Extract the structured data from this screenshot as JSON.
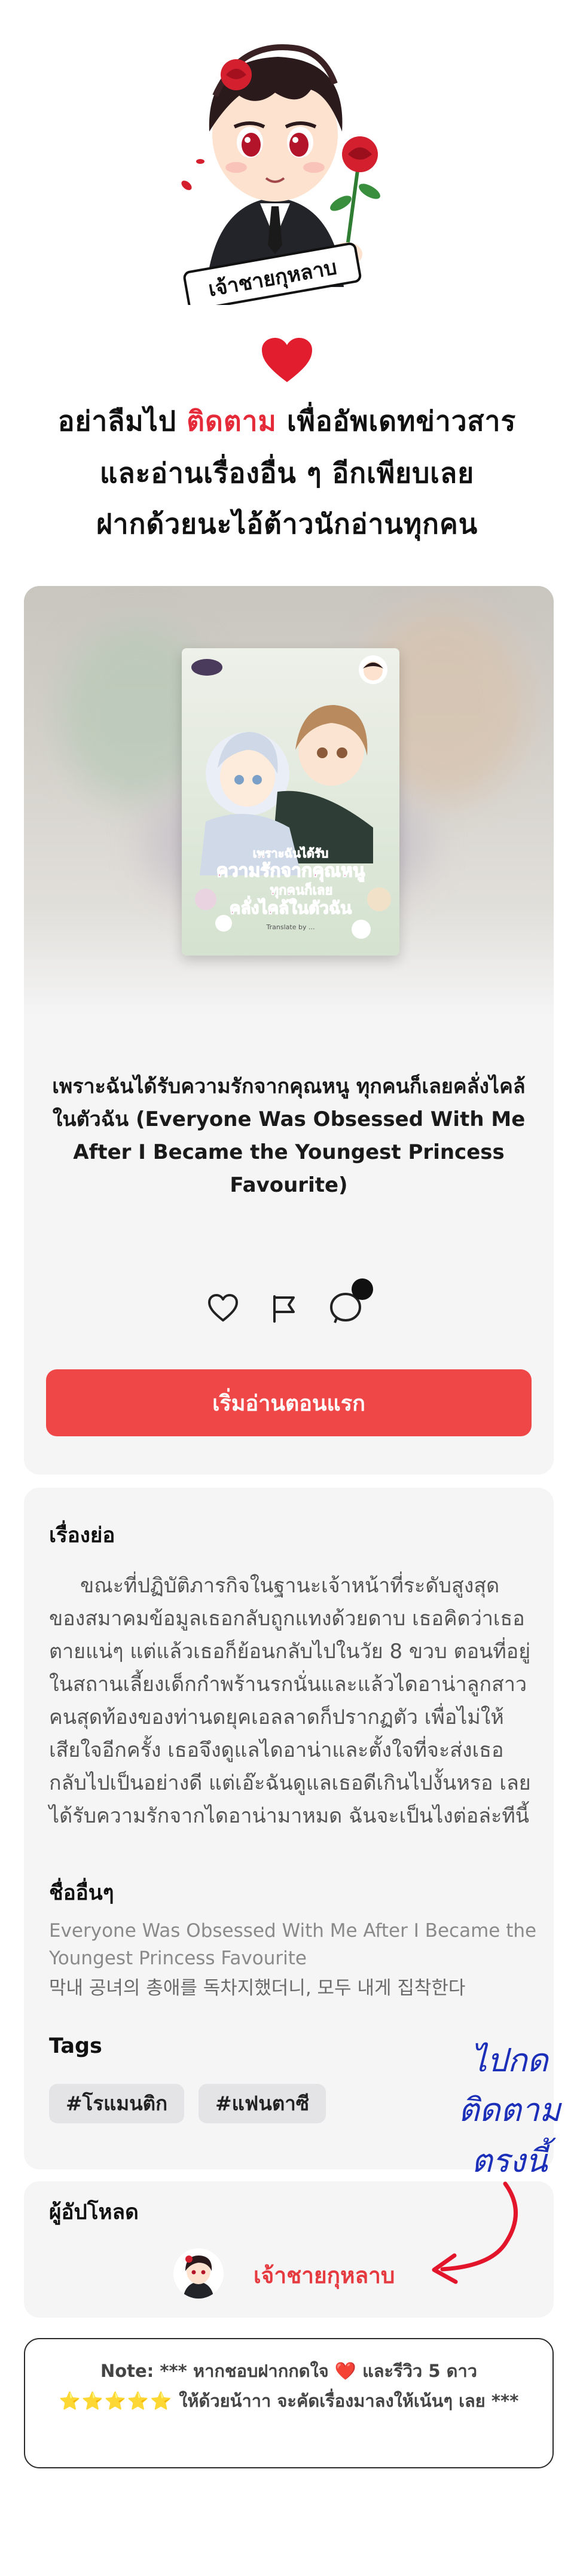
{
  "promo": {
    "mascot_sign": "เจ้าชายกุหลาบ",
    "line1_a": "อย่าลืมไป ",
    "line1_accent": "ติดตาม",
    "line1_b": " เพื่ออัพเดทข่าวสาร",
    "line2": "และอ่านเรื่องอื่น ๆ อีกเพียบเลย",
    "line3": "ฝากด้วยนะไอ้ต้าวนักอ่านทุกคน",
    "accent_color": "#e52b3a"
  },
  "book": {
    "cover_title_lines": [
      "เพราะฉันได้รับ",
      "ความรักจากคุณหนู",
      "ทุกคนก็เลย",
      "คลั่งไคล้ในตัวฉัน"
    ],
    "cover_credit": "Translate by ...",
    "title": "เพราะฉันได้รับความรักจากคุณหนู ทุกคนก็เลยคลั่งไคล้ในตัวฉัน (Everyone Was Obsessed With Me After I Became the Youngest Princess Favourite)",
    "read_button": "เริ่มอ่านตอนแรก",
    "button_color": "#ef4747"
  },
  "actions": {
    "like_icon": "heart-outline-icon",
    "report_icon": "flag-icon",
    "comment_icon": "comment-icon"
  },
  "info": {
    "synopsis_label": "เรื่องย่อ",
    "synopsis": "ขณะที่ปฏิบัติภารกิจในฐานะเจ้าหน้าที่ระดับสูงสุดของสมาคมข้อมูลเธอกลับถูกแทงด้วยดาบ เธอคิดว่าเธอตายแน่ๆ แต่แล้วเธอก็ย้อนกลับไปในวัย 8 ขวบ ตอนที่อยู่ในสถานเลี้ยงเด็กกำพร้านรกนั่นและแล้วไดอาน่าลูกสาวคนสุดท้องของท่านดยุคเอลลาดก็ปรากฏตัว เพื่อไม่ให้เสียใจอีกครั้ง เธอจึงดูแลไดอาน่าและตั้งใจที่จะส่งเธอกลับไปเป็นอย่างดี แต่เอ๊ะฉันดูแลเธอดีเกินไปงั้นหรอ เลยได้รับความรักจากไดอาน่ามาหมด ฉันจะเป็นไงต่อล่ะทีนี้",
    "alt_names_label": "ชื่ออื่นๆ",
    "alt_name_en": "Everyone Was Obsessed With Me After I Became the Youngest Princess Favourite",
    "alt_name_ko": "막내 공녀의 총애를 독차지했더니, 모두 내게 집착한다",
    "tags_label": "Tags",
    "tags": [
      "#โรแมนติก",
      "#แฟนตาซี"
    ]
  },
  "uploader": {
    "label": "ผู้อัปโหลด",
    "name": "เจ้าชายกุหลาบ"
  },
  "annotation": {
    "line1": "ไปกด",
    "line2": "ติดตาม",
    "line3": "ตรงนี้"
  },
  "note": {
    "prefix": "Note: *** หากชอบฝากกดใจ ",
    "heart": "❤️",
    "mid": " และรีวิว 5 ดาว",
    "stars": "⭐⭐⭐⭐⭐",
    "suffix": " ให้ด้วยน้าาา จะคัดเรื่องมาลงให้เน้นๆ เลย ***"
  }
}
